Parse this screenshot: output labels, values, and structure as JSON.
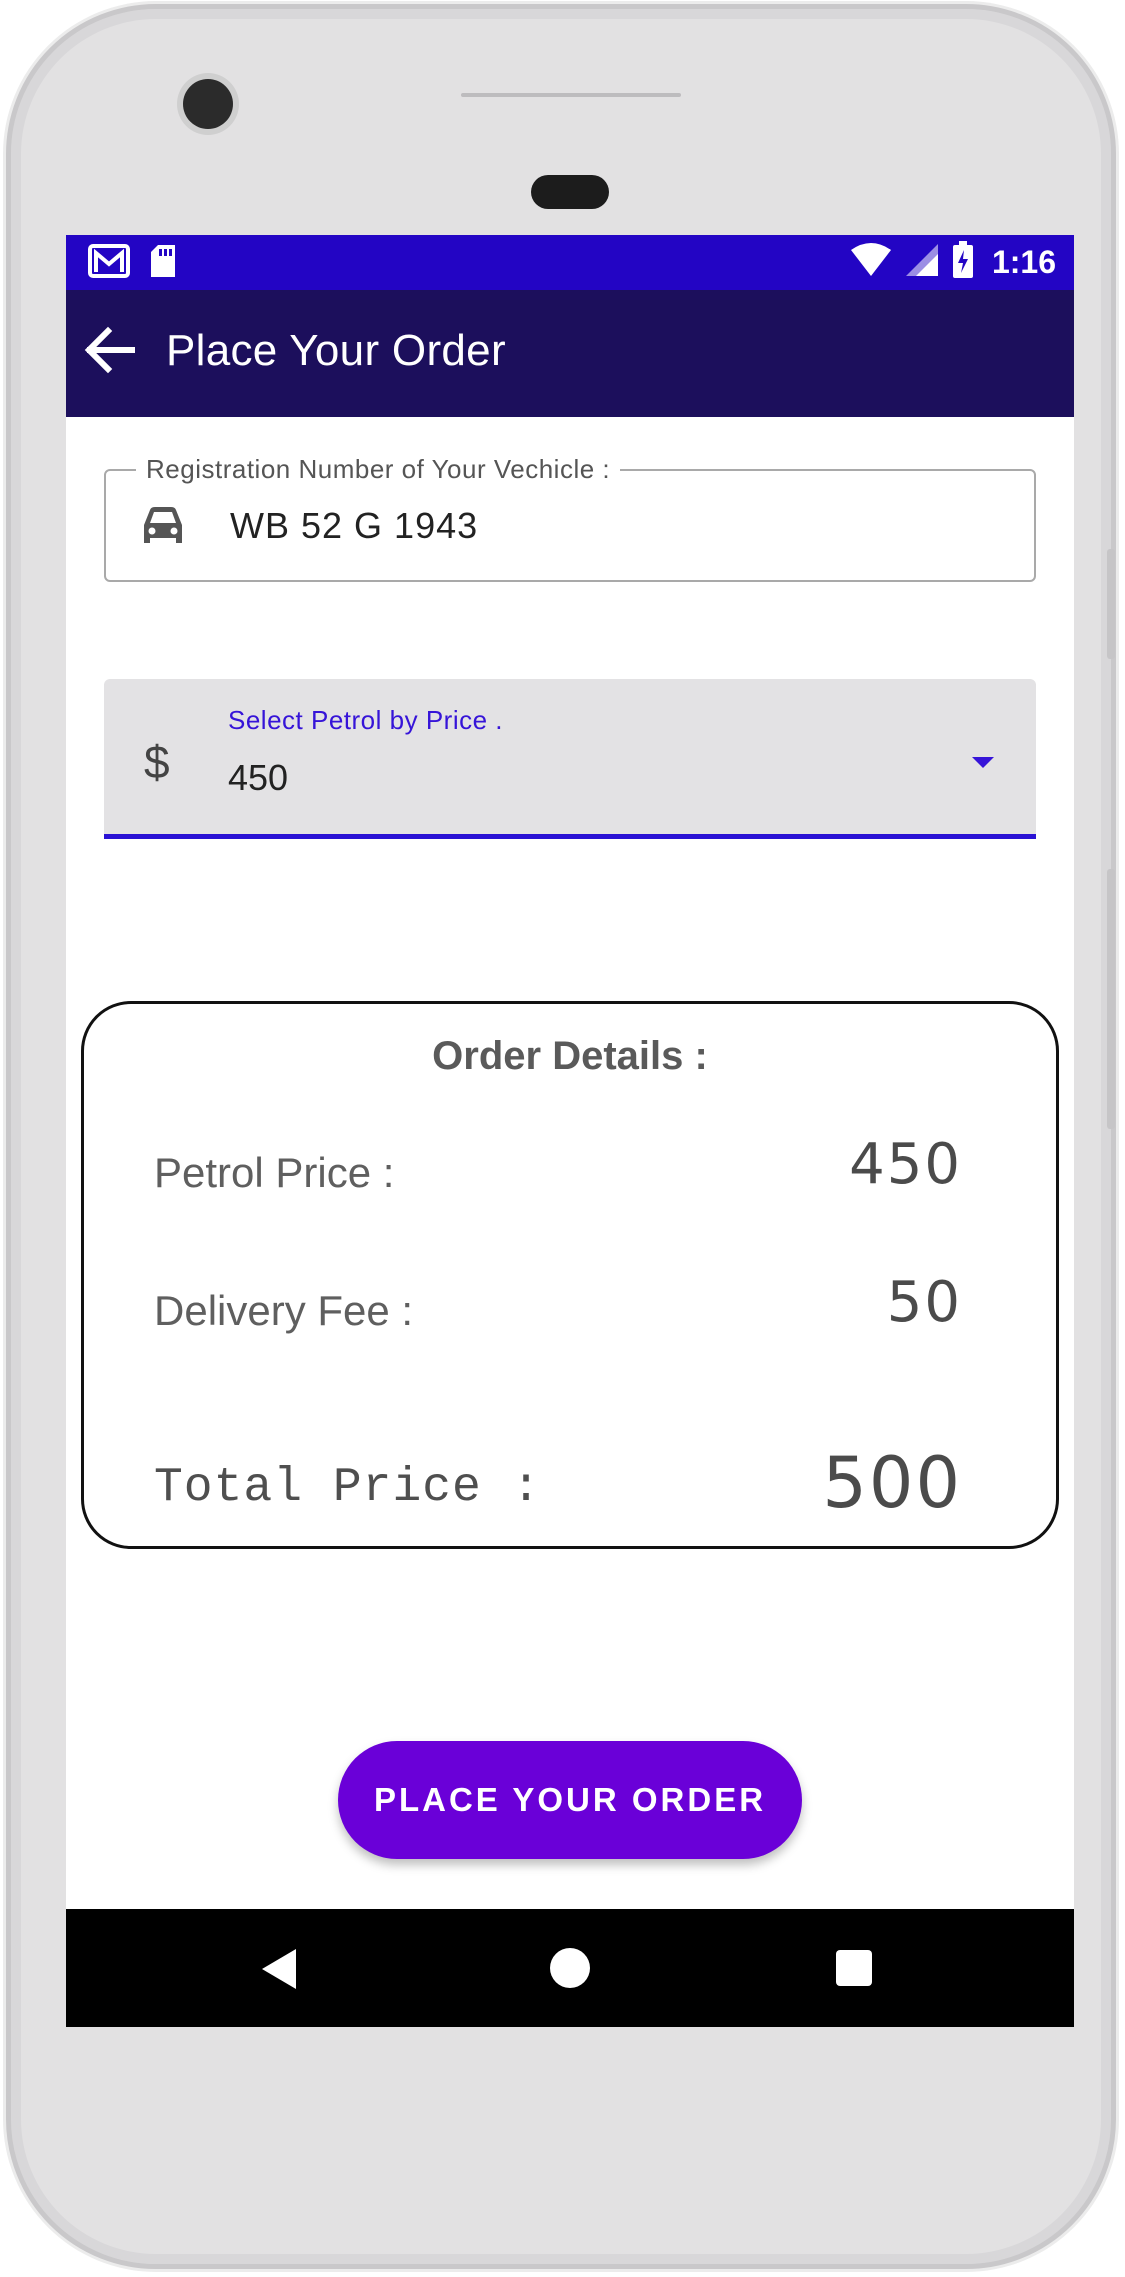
{
  "status_bar": {
    "time": "1:16",
    "left_icons": [
      "gmail-icon",
      "sd-card-icon"
    ],
    "right_icons": [
      "wifi-icon",
      "signal-icon",
      "battery-charging-icon"
    ],
    "color": "#2305c4"
  },
  "app_bar": {
    "title": "Place Your Order",
    "color": "#1c0f5c"
  },
  "registration_field": {
    "label": "Registration Number of Your Vechicle :",
    "value": "WB 52 G 1943",
    "icon": "car-icon"
  },
  "petrol_select": {
    "label": "Select Petrol by Price .",
    "value": "450",
    "icon": "dollar-icon",
    "accent": "#3614d8"
  },
  "order_details": {
    "title": "Order Details :",
    "petrol_price_label": "Petrol Price :",
    "petrol_price_value": "450",
    "delivery_fee_label": "Delivery Fee :",
    "delivery_fee_value": "50",
    "total_label": "Total Price :",
    "total_value": "500"
  },
  "place_order_button": {
    "label": "PLACE YOUR ORDER",
    "color": "#6a00d8"
  },
  "nav_bar": {
    "icons": [
      "back-icon",
      "home-icon",
      "recents-icon"
    ]
  }
}
